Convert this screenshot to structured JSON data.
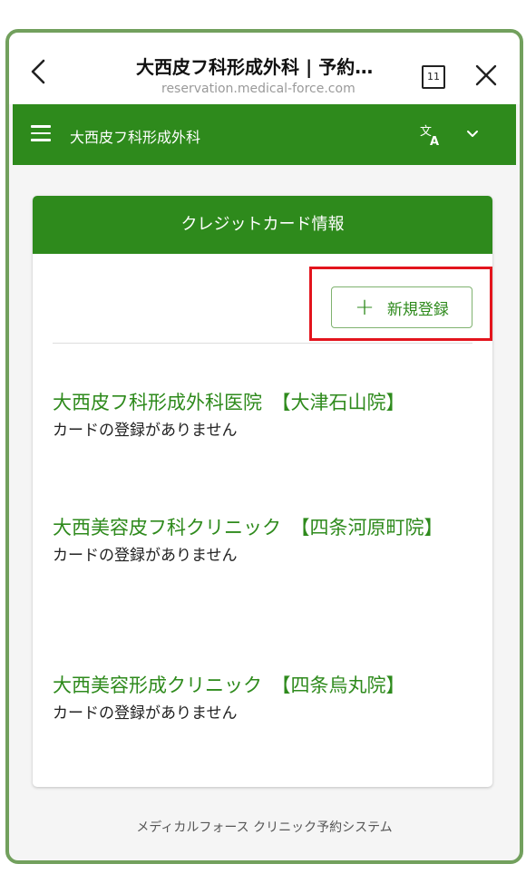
{
  "browser": {
    "title": "大西皮フ科形成外科 | 予約…",
    "url": "reservation.medical-force.com",
    "tab_count": "11"
  },
  "header": {
    "clinic_name": "大西皮フ科形成外科"
  },
  "card": {
    "title": "クレジットカード情報",
    "register_label": "新規登録",
    "clinics": [
      {
        "name": "大西皮フ科形成外科医院　【大津石山院】",
        "status": "カードの登録がありません"
      },
      {
        "name": "大西美容皮フ科クリニック　【四条河原町院】",
        "status": "カードの登録がありません"
      },
      {
        "name": "大西美容形成クリニック　【四条烏丸院】",
        "status": "カードの登録がありません"
      }
    ]
  },
  "footer": {
    "text": "メディカルフォース クリニック予約システム"
  },
  "colors": {
    "brand_green": "#2e8a1c",
    "frame_green": "#72a05d",
    "highlight_red": "#e3141d"
  },
  "icons": [
    "back-arrow-icon",
    "tabs-icon",
    "close-icon",
    "menu-icon",
    "translate-icon",
    "chevron-down-icon",
    "plus-icon"
  ]
}
